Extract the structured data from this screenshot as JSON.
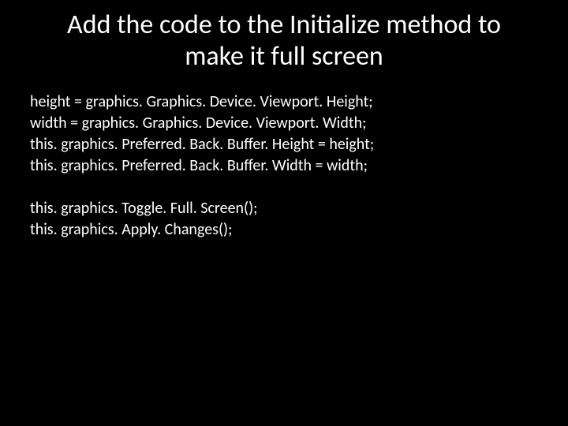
{
  "slide": {
    "title": "Add the code to the Initialize method to make it full screen",
    "code_lines": [
      "height = graphics. Graphics. Device. Viewport. Height;",
      "width = graphics. Graphics. Device. Viewport. Width;",
      "this. graphics. Preferred. Back. Buffer. Height = height;",
      "this. graphics. Preferred. Back. Buffer. Width = width;"
    ],
    "code_lines2": [
      "this. graphics. Toggle. Full. Screen();",
      "this. graphics. Apply. Changes();"
    ]
  }
}
